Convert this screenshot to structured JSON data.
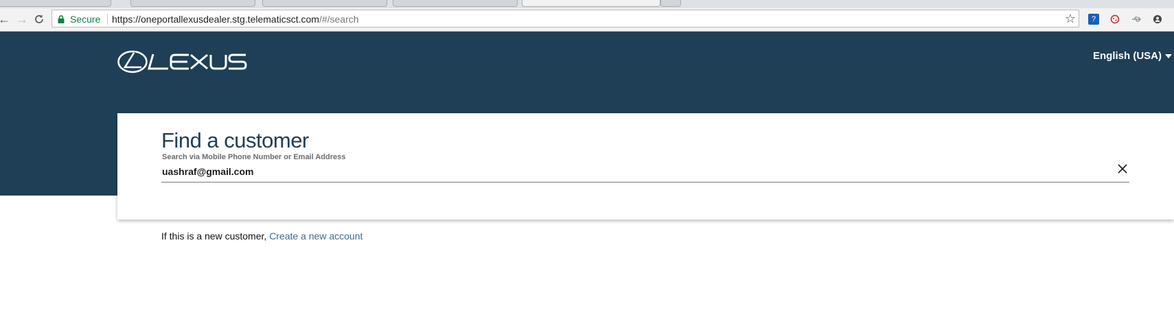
{
  "browser": {
    "security_label": "Secure",
    "url_host": "https://oneportallexusdealer.stg.telematicsct.com",
    "url_path": "/#/search",
    "extensions": [
      "question-extension-icon",
      "cookie-extension-icon",
      "usb-extension-icon",
      "profile-extension-icon"
    ]
  },
  "header": {
    "brand": "LEXUS",
    "language": "English (USA)",
    "background_color": "#1f3f56"
  },
  "search_card": {
    "title": "Find a customer",
    "subtitle": "Search via Mobile Phone Number or Email Address",
    "input_value": "uashraf@gmail.com"
  },
  "new_customer": {
    "prefix": "If this is a new customer,",
    "link_label": "Create a new account"
  }
}
